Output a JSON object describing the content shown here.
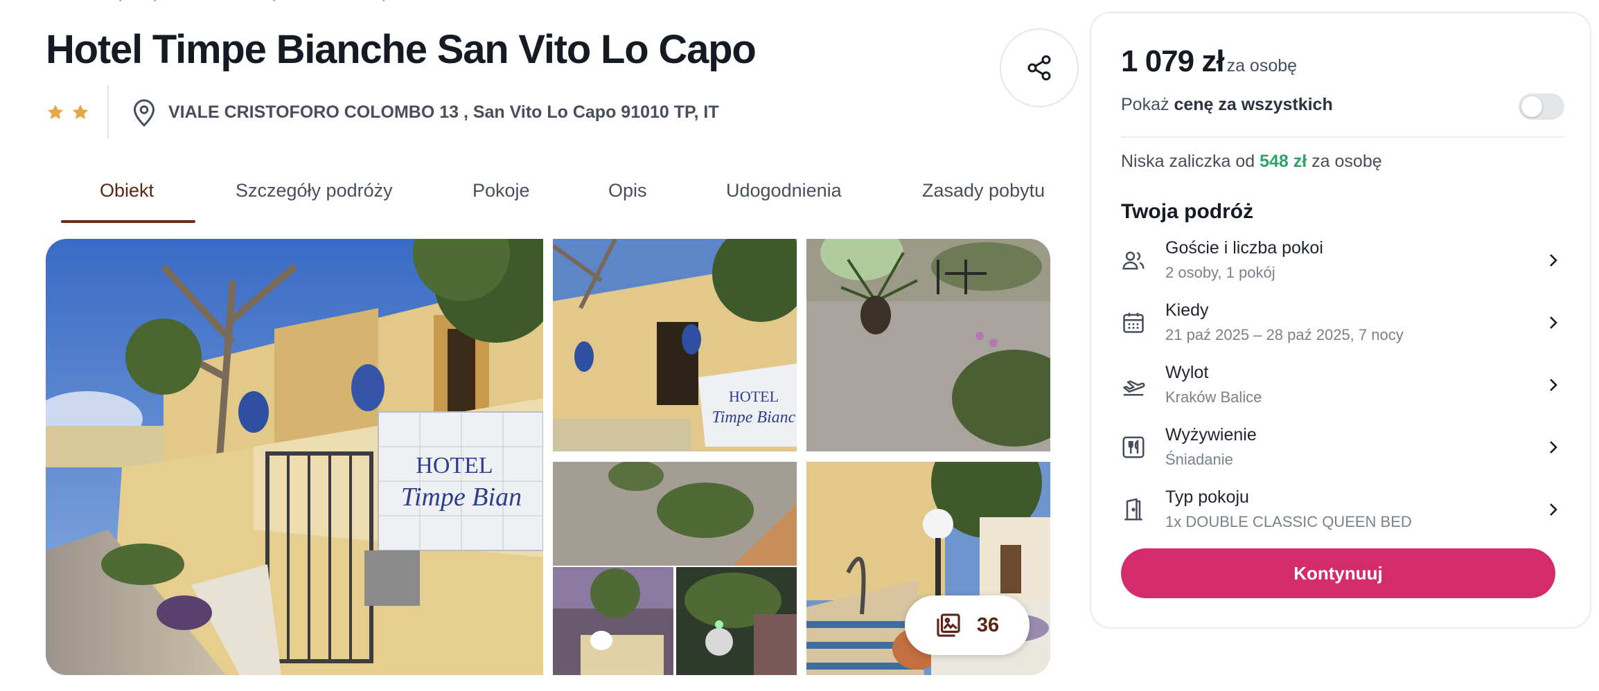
{
  "hotel": {
    "name": "Hotel Timpe Bianche San Vito Lo Capo",
    "stars": 2,
    "address": "VIALE CRISTOFORO COLOMBO 13 , San Vito Lo Capo 91010 TP, IT"
  },
  "tabs": [
    {
      "label": "Obiekt",
      "active": true
    },
    {
      "label": "Szczegóły podróży",
      "active": false
    },
    {
      "label": "Pokoje",
      "active": false
    },
    {
      "label": "Opis",
      "active": false
    },
    {
      "label": "Udogodnienia",
      "active": false
    },
    {
      "label": "Zasady pobytu",
      "active": false
    }
  ],
  "gallery": {
    "photo_count": "36",
    "icons": {
      "share": "share-icon",
      "photos": "photo-library-icon"
    }
  },
  "booking": {
    "price": "1 079 zł",
    "price_unit": "za osobę",
    "toggle_prefix": "Pokaż",
    "toggle_bold": "cenę za wszystkich",
    "toggle_on": false,
    "deposit_prefix": "Niska zaliczka od",
    "deposit_amount": "548 zł",
    "deposit_suffix": "za osobę",
    "trip_title": "Twoja podróż",
    "rows": [
      {
        "icon": "guests-icon",
        "label": "Goście i liczba pokoi",
        "value": "2 osoby, 1 pokój"
      },
      {
        "icon": "calendar-icon",
        "label": "Kiedy",
        "value": "21 paź 2025 – 28 paź 2025, 7 nocy"
      },
      {
        "icon": "plane-departure-icon",
        "label": "Wylot",
        "value": "Kraków Balice"
      },
      {
        "icon": "meal-icon",
        "label": "Wyżywienie",
        "value": "Śniadanie"
      },
      {
        "icon": "room-door-icon",
        "label": "Typ pokoju",
        "value": "1x DOUBLE CLASSIC QUEEN BED"
      }
    ],
    "cta": "Kontynuuj"
  },
  "colors": {
    "accent": "#d42c6a",
    "tab_active": "#5b2614",
    "deposit_green": "#2ea36a",
    "star": "#e8a84a"
  }
}
